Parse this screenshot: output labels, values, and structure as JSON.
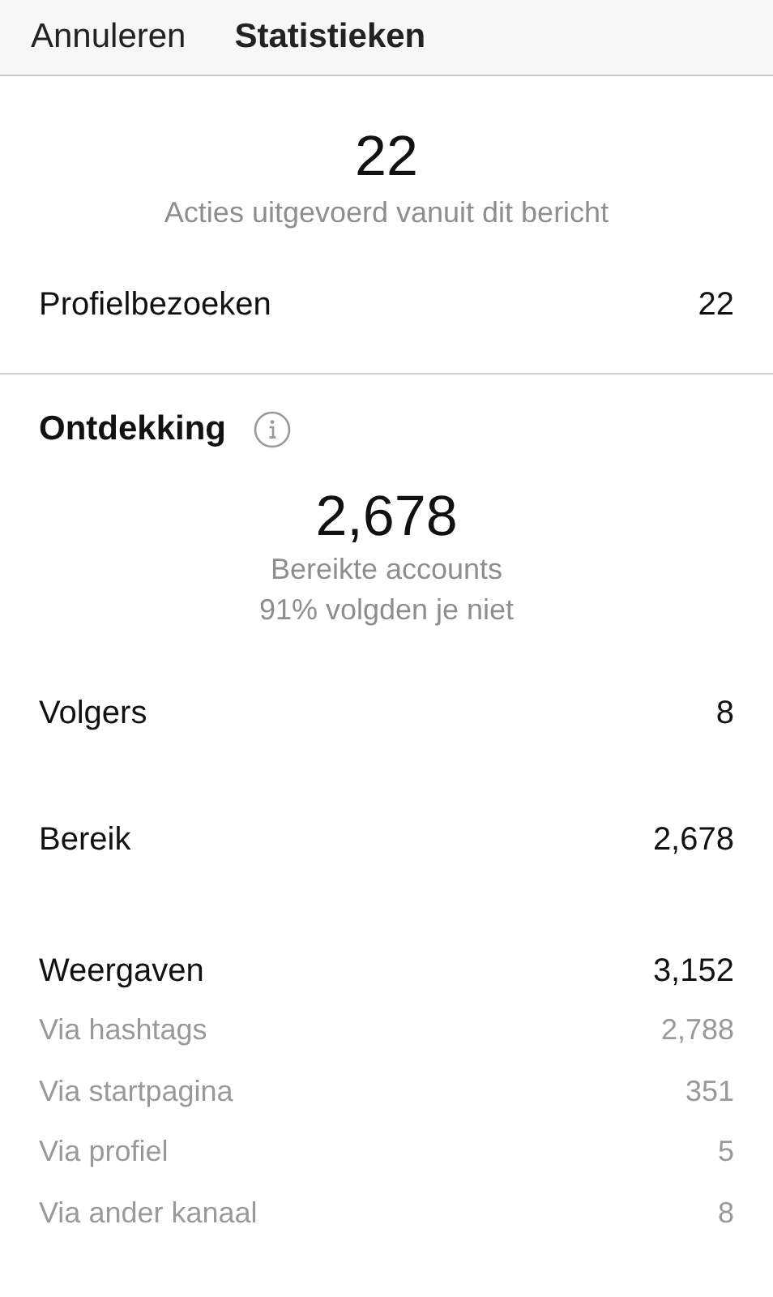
{
  "header": {
    "cancel": "Annuleren",
    "title": "Statistieken"
  },
  "interactions": {
    "value": "22",
    "caption": "Acties uitgevoerd vanuit dit bericht",
    "rows": [
      {
        "kind": "main",
        "label": "Profielbezoeken",
        "value": "22"
      }
    ]
  },
  "discovery": {
    "title": "Ontdekking",
    "value": "2,678",
    "caption": "Bereikte accounts",
    "subcaption": "91% volgden je niet",
    "rows": [
      {
        "kind": "main",
        "label": "Volgers",
        "value": "8"
      },
      {
        "kind": "main",
        "label": "Bereik",
        "value": "2,678"
      },
      {
        "kind": "main",
        "label": "Weergaven",
        "value": "3,152"
      },
      {
        "kind": "sub",
        "label": "Via hashtags",
        "value": "2,788"
      },
      {
        "kind": "sub",
        "label": "Via startpagina",
        "value": "351"
      },
      {
        "kind": "sub",
        "label": "Via profiel",
        "value": "5"
      },
      {
        "kind": "sub",
        "label": "Via ander kanaal",
        "value": "8"
      }
    ]
  }
}
